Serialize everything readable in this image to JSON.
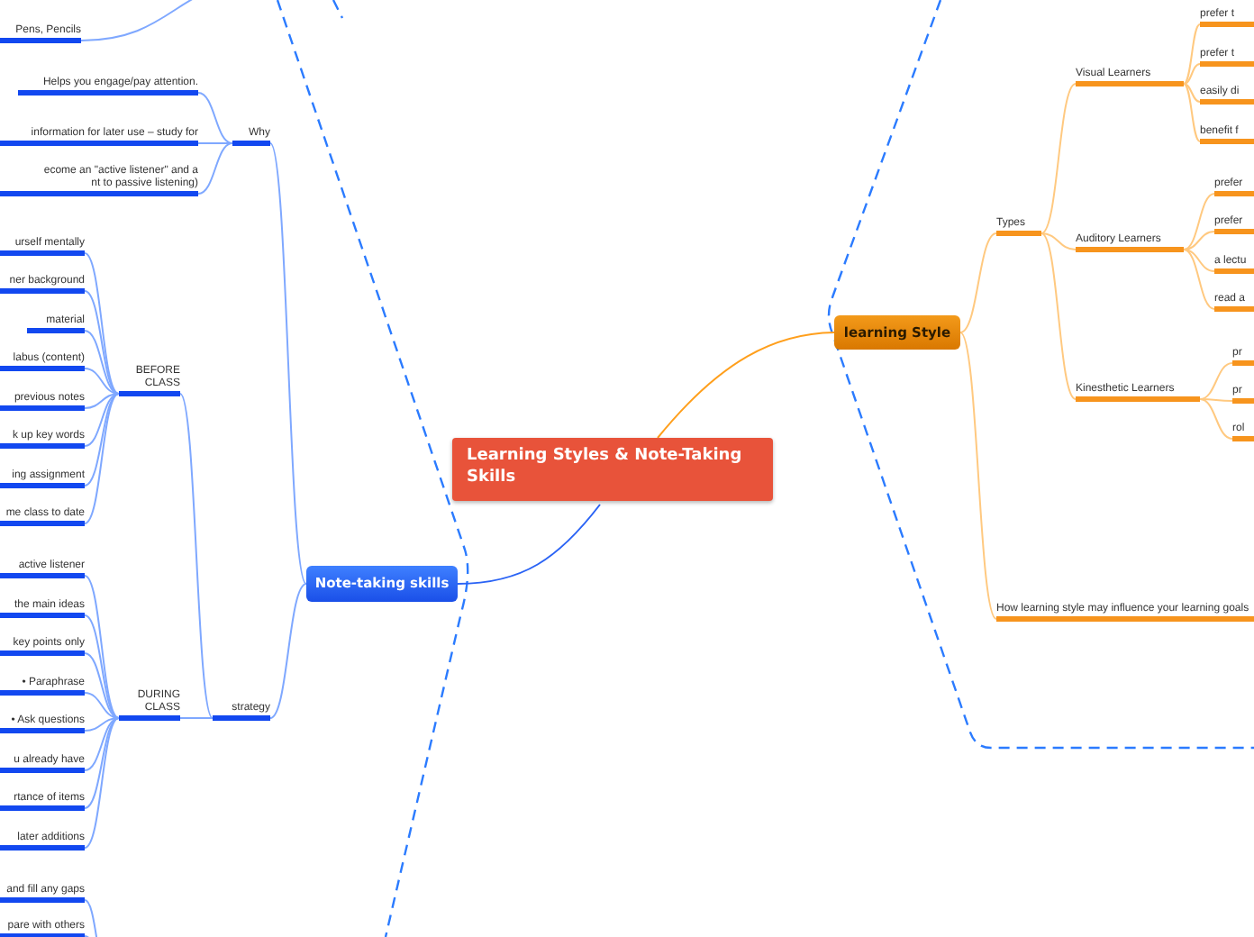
{
  "central_topic": {
    "title": "Learning Styles & Note-Taking Skills"
  },
  "branches": [
    {
      "title": "Note-taking skills",
      "children": [
        {
          "children": [
            {
              "text": "Pens, Pencils"
            }
          ]
        },
        {
          "text": "Why",
          "children": [
            {
              "text": "Helps you engage/pay attention."
            },
            {
              "text": "information for later use – study for"
            },
            {
              "text": "ecome an \"active listener\" and a\nnt to passive listening)"
            }
          ]
        },
        {
          "text": "strategy",
          "children": [
            {
              "text": "BEFORE\nCLASS",
              "children": [
                {
                  "text": "urself mentally"
                },
                {
                  "text": "ner background"
                },
                {
                  "text": "material"
                },
                {
                  "text": "labus (content)"
                },
                {
                  "text": "previous notes"
                },
                {
                  "text": "k up key words"
                },
                {
                  "text": "ing assignment"
                },
                {
                  "text": "me class to date"
                }
              ]
            },
            {
              "text": "DURING\nCLASS",
              "children": [
                {
                  "text": "active listener"
                },
                {
                  "text": "the main ideas"
                },
                {
                  "text": "key points only"
                },
                {
                  "text": "• Paraphrase"
                },
                {
                  "text": "• Ask questions"
                },
                {
                  "text": "u already have"
                },
                {
                  "text": "rtance of items"
                },
                {
                  "text": "later additions"
                }
              ]
            },
            {
              "children": [
                {
                  "text": "and fill any gaps"
                },
                {
                  "text": "pare with others"
                }
              ]
            }
          ]
        }
      ]
    },
    {
      "title": "learning Style",
      "children": [
        {
          "text": "Types",
          "children": [
            {
              "text": "Visual Learners",
              "children": [
                {
                  "text": "prefer t"
                },
                {
                  "text": "prefer t"
                },
                {
                  "text": "easily di"
                },
                {
                  "text": "benefit f"
                }
              ]
            },
            {
              "text": "Auditory Learners",
              "children": [
                {
                  "text": "prefer"
                },
                {
                  "text": "prefer"
                },
                {
                  "text": "a lectu"
                },
                {
                  "text": "read a"
                }
              ]
            },
            {
              "text": "Kinesthetic Learners",
              "children": [
                {
                  "text": "pr"
                },
                {
                  "text": "pr"
                },
                {
                  "text": "rol"
                }
              ]
            }
          ]
        },
        {
          "text": "How learning style may influence your learning goals"
        }
      ]
    }
  ]
}
